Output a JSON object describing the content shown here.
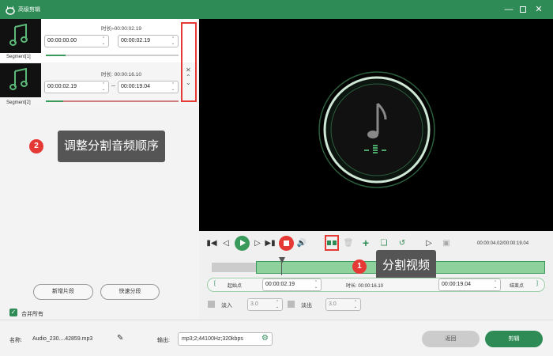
{
  "window": {
    "title": "高级剪辑"
  },
  "segments": [
    {
      "label": "Segment[1]",
      "duration_label": "时长: 00:00:02.19",
      "start": "00:00:00.00",
      "end": "00:00:02.19"
    },
    {
      "label": "Segment[2]",
      "duration_label": "时长: 00:00:16.10",
      "start": "00:00:02.19",
      "end": "00:00:19.04"
    }
  ],
  "callouts": [
    {
      "number": "1",
      "text": "分割视频"
    },
    {
      "number": "2",
      "text": "调整分割音频顺序"
    }
  ],
  "left_actions": {
    "new_segment": "新增片段",
    "fast_split": "快速分段",
    "merge_all": "合并所有"
  },
  "player": {
    "time_display": "00:00:04.02/00:00:19.04"
  },
  "trim": {
    "set_start_label": "起始点",
    "start_value": "00:00:02.19",
    "duration_label": "时长: 00:00:16.10",
    "end_value": "00:00:19.04",
    "set_end_label": "结束点"
  },
  "fade": {
    "fade_in_label": "淡入",
    "fade_in_value": "3.0",
    "fade_out_label": "淡出",
    "fade_out_value": "3.0"
  },
  "bottom": {
    "name_label": "名称:",
    "name_value": "Audio_230....42859.mp3",
    "output_label": "输出:",
    "output_value": "mp3;2;44100Hz;320kbps",
    "back_label": "返回",
    "cut_label": "剪辑"
  },
  "colors": {
    "brand_green": "#2e8b55",
    "highlight_red": "#e53935"
  }
}
